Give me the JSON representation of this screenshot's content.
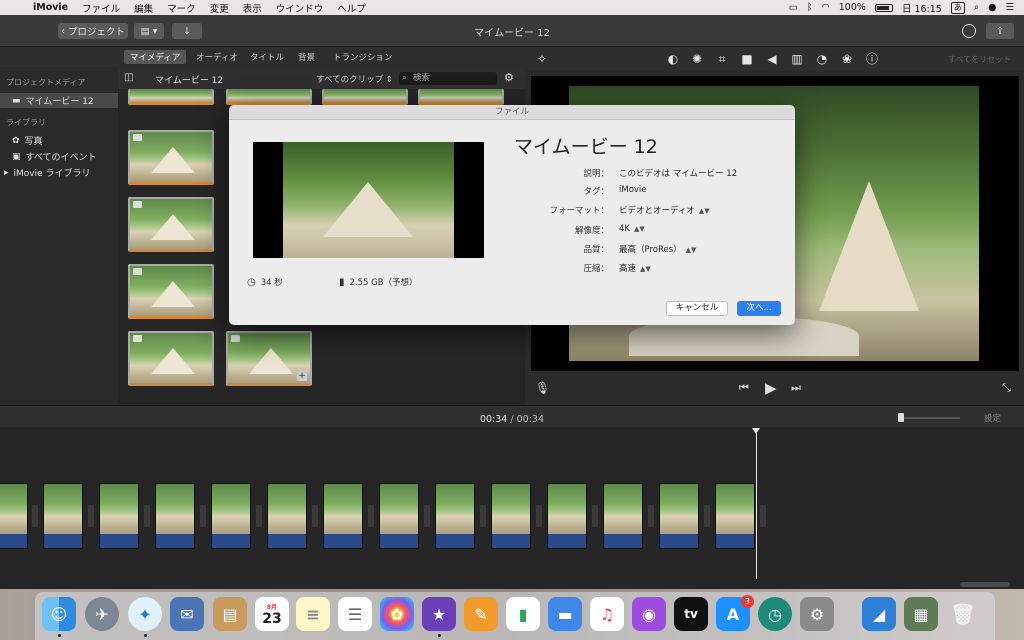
{
  "menubar": {
    "app": "iMovie",
    "items": [
      "ファイル",
      "編集",
      "マーク",
      "変更",
      "表示",
      "ウインドウ",
      "ヘルプ"
    ],
    "battery": "100%",
    "clock": "日 16:15",
    "input_method": "あ"
  },
  "toolbar": {
    "back_label": "プロジェクト",
    "title": "マイムービー 12"
  },
  "browser_tabs": [
    "マイメディア",
    "オーディオ",
    "タイトル",
    "背景",
    "トランジション"
  ],
  "sidebar": {
    "project_media_header": "プロジェクトメディア",
    "project_item": "マイムービー 12",
    "library_header": "ライブラリ",
    "library_items": [
      "写真",
      "すべてのイベント",
      "iMovie ライブラリ"
    ]
  },
  "browser": {
    "title": "マイムービー 12",
    "filter": "すべてのクリップ",
    "search_placeholder": "検索"
  },
  "viewer": {
    "reset_all": "すべてをリセット"
  },
  "timeline": {
    "current_time": "00:34",
    "separator": "/",
    "total_time": "00:34",
    "settings_label": "設定"
  },
  "dialog": {
    "window_title": "ファイル",
    "title": "マイムービー 12",
    "fields": [
      {
        "label": "説明：",
        "value": "このビデオは マイムービー 12",
        "stepper": false
      },
      {
        "label": "タグ：",
        "value": "iMovie",
        "stepper": false
      },
      {
        "label": "フォーマット：",
        "value": "ビデオとオーディオ",
        "stepper": true
      },
      {
        "label": "解像度：",
        "value": "4K",
        "stepper": true
      },
      {
        "label": "品質：",
        "value": "最高（ProRes）",
        "stepper": true
      },
      {
        "label": "圧縮：",
        "value": "高速",
        "stepper": true
      }
    ],
    "duration": "34 秒",
    "file_size": "2.55 GB（予想）",
    "cancel_label": "キャンセル",
    "next_label": "次へ..."
  },
  "dock": {
    "calendar_month": "8月",
    "calendar_day": "23",
    "appstore_badge": "3",
    "appletv_label": "tv"
  },
  "colors": {
    "accent": "#2d7ff0",
    "clip_border": "#d08a3a",
    "timeline_audio": "#2b4a8a"
  }
}
